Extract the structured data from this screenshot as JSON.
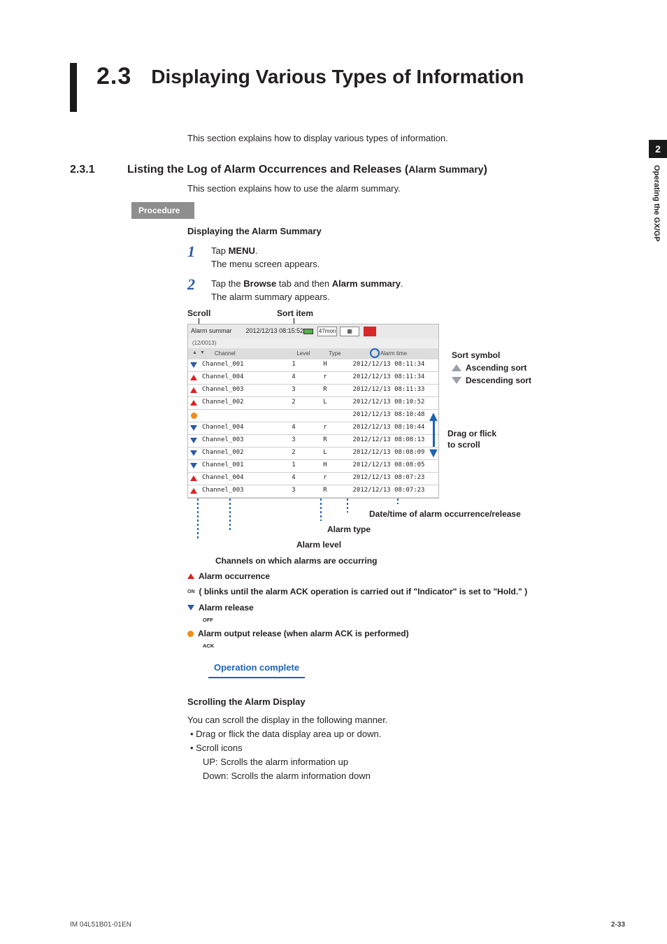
{
  "sectionNumber": "2.3",
  "sectionTitle": "Displaying Various Types of Information",
  "intro": "This section explains how to display various types of information.",
  "sub": {
    "num": "2.3.1",
    "titleMain": "Listing the Log of Alarm Occurrences and Releases (",
    "titleParen": "Alarm Summary",
    "titleEnd": ")",
    "desc": "This section explains how to use the alarm summary."
  },
  "procLabel": "Procedure",
  "heading1": "Displaying the Alarm Summary",
  "steps": {
    "s1": {
      "n": "1",
      "a": "Tap ",
      "b": "MENU",
      "c": ".",
      "d": "The menu screen appears."
    },
    "s2": {
      "n": "2",
      "a": "Tap the ",
      "b": "Browse",
      "c": " tab and then ",
      "d": "Alarm summary",
      "e": ".",
      "f": "The alarm summary appears."
    }
  },
  "figLabels": {
    "scroll": "Scroll",
    "sortItem": "Sort item",
    "sortSymbol": "Sort symbol",
    "ascending": "Ascending sort",
    "descending": "Descending sort",
    "drag1": "Drag or flick",
    "drag2": "to scroll",
    "dateTime": "Date/time of alarm occurrence/release",
    "alarmType": "Alarm type",
    "alarmLevel": "Alarm level",
    "channelsOccurring": "Channels on which alarms are occurring",
    "occurrence": "Alarm occurrence",
    "blinkNote": "(     blinks until the alarm ACK operation is carried out if \"Indicator\" is set to \"Hold.\"  )",
    "release": "Alarm release",
    "outRelease": "Alarm output release (when alarm ACK is performed)"
  },
  "opComplete": "Operation complete",
  "scrollHeading": "Scrolling the Alarm Display",
  "scrollDesc": "You can scroll the display in the following manner.",
  "scrollBullets": {
    "b1": "Drag or flick the data display area up or down.",
    "b2": "Scroll icons",
    "b2a": "UP: Scrolls the alarm information up",
    "b2b": "Down: Scrolls the alarm information down"
  },
  "shot": {
    "title1": "Alarm",
    "title2": "summar",
    "timestamp": "2012/12/13 08:15:52",
    "batch": "(12/0013)",
    "btnTimeUnit": "47mon",
    "cols": {
      "updown": "UP    DOWN",
      "ch": "Channel",
      "lvl": "Level",
      "tp": "Type",
      "tm": "Alarm time"
    }
  },
  "rows": [
    {
      "ico": "dn",
      "ch": "Channel_001",
      "lvl": "1",
      "tp": "H",
      "tm": "2012/12/13 08:11:34"
    },
    {
      "ico": "up",
      "ch": "Channel_004",
      "lvl": "4",
      "tp": "r",
      "tm": "2012/12/13 08:11:34"
    },
    {
      "ico": "up",
      "ch": "Channel_003",
      "lvl": "3",
      "tp": "R",
      "tm": "2012/12/13 08:11:33"
    },
    {
      "ico": "up",
      "ch": "Channel_002",
      "lvl": "2",
      "tp": "L",
      "tm": "2012/12/13 08:10:52"
    },
    {
      "ico": "ci",
      "ch": "",
      "lvl": "",
      "tp": "",
      "tm": "2012/12/13 08:10:48"
    },
    {
      "ico": "dn",
      "ch": "Channel_004",
      "lvl": "4",
      "tp": "r",
      "tm": "2012/12/13 08:10:44"
    },
    {
      "ico": "dn",
      "ch": "Channel_003",
      "lvl": "3",
      "tp": "R",
      "tm": "2012/12/13 08:08:13"
    },
    {
      "ico": "dn",
      "ch": "Channel_002",
      "lvl": "2",
      "tp": "L",
      "tm": "2012/12/13 08:08:09"
    },
    {
      "ico": "dn",
      "ch": "Channel_001",
      "lvl": "1",
      "tp": "H",
      "tm": "2012/12/13 08:08:05"
    },
    {
      "ico": "up",
      "ch": "Channel_004",
      "lvl": "4",
      "tp": "r",
      "tm": "2012/12/13 08:07:23"
    },
    {
      "ico": "up",
      "ch": "Channel_003",
      "lvl": "3",
      "tp": "R",
      "tm": "2012/12/13 08:07:23"
    }
  ],
  "tinyOn": "ON",
  "tinyOff": "OFF",
  "tinyAck": "ACK",
  "sideTab": {
    "num": "2",
    "text": "Operating the GX/GP"
  },
  "footer": {
    "left": "IM 04L51B01-01EN",
    "right": "2-33"
  }
}
